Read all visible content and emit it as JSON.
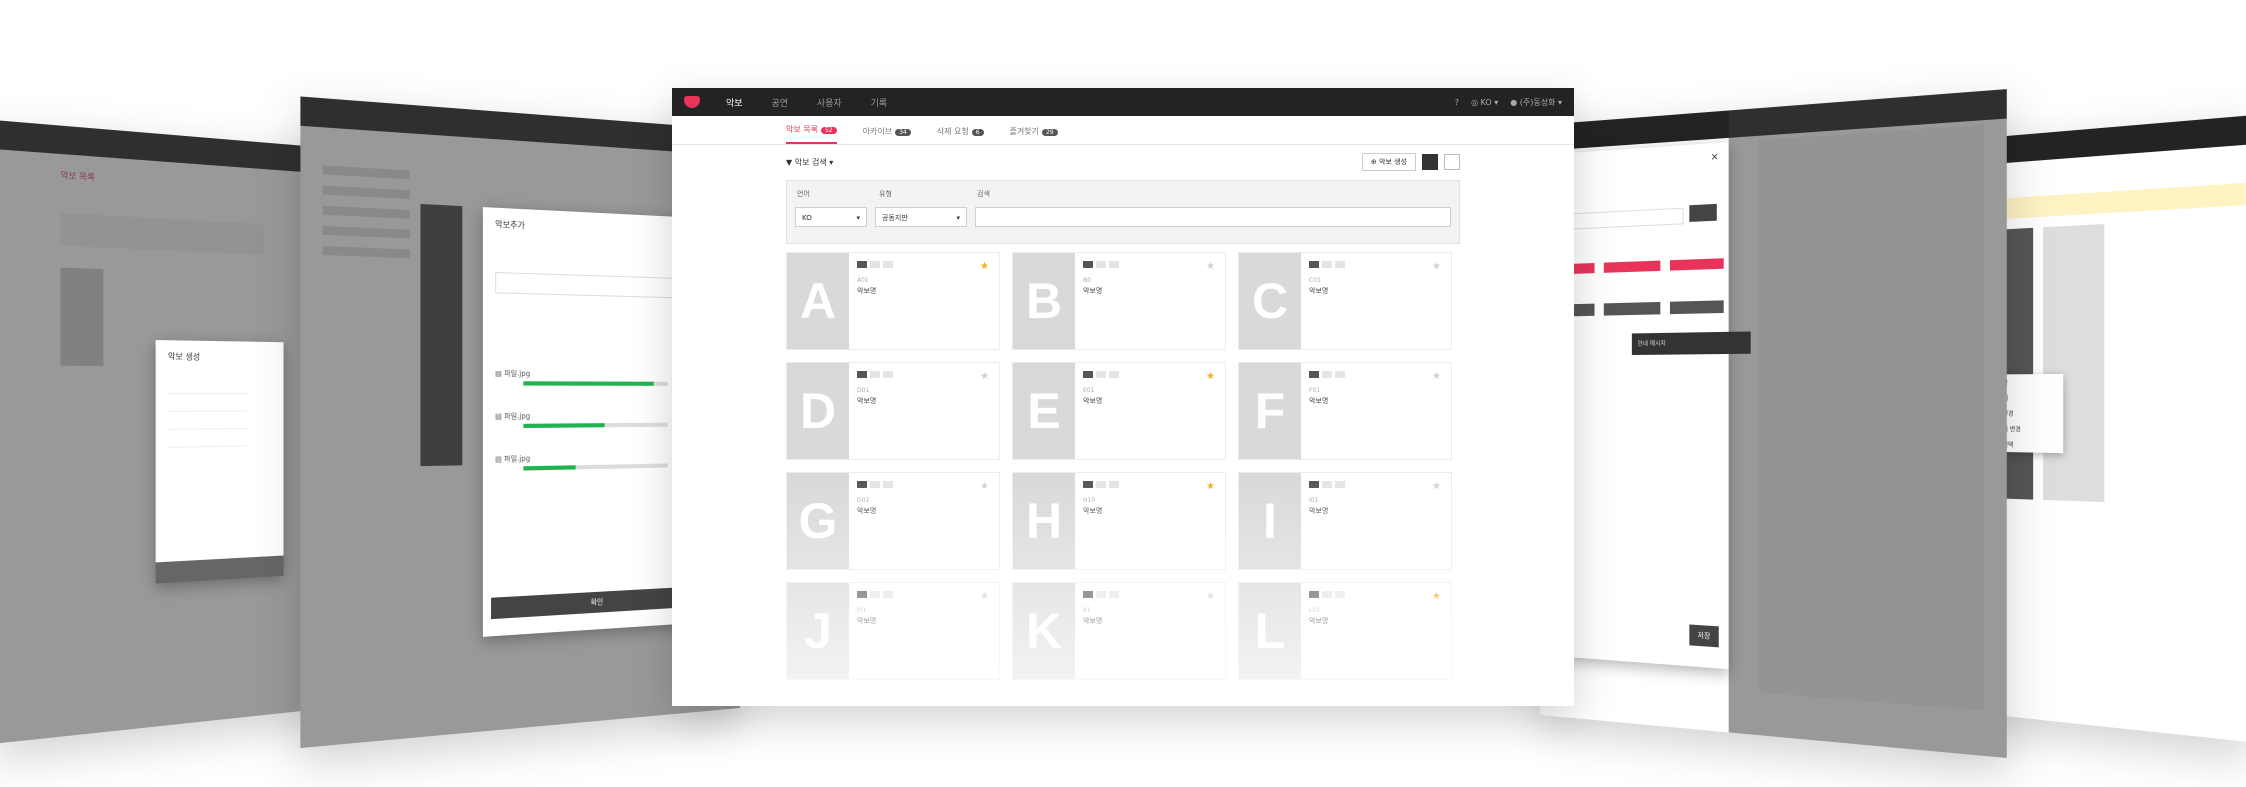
{
  "main": {
    "nav": [
      "악보",
      "공연",
      "사용자",
      "기록"
    ],
    "active_nav": "악보",
    "header_right": {
      "lang": "KO",
      "user": "(주)동성화"
    },
    "tabs": [
      {
        "label": "악보 목록",
        "count": "52"
      },
      {
        "label": "아카이브",
        "count": "34"
      },
      {
        "label": "삭제 요청",
        "count": "6"
      },
      {
        "label": "즐겨찾기",
        "count": "29"
      }
    ],
    "toolbar": {
      "filter_label": "악보 검색",
      "create_label": "악보 생성"
    },
    "filters": {
      "lang_label": "언어",
      "lang_value": "KO",
      "type_label": "유형",
      "type_value": "공동지판",
      "search_label": "검색",
      "search_placeholder": ""
    },
    "cards": [
      {
        "letter": "A",
        "id": "A01",
        "name": "악보명",
        "fav": true
      },
      {
        "letter": "B",
        "id": "B0",
        "name": "악보명",
        "fav": false
      },
      {
        "letter": "C",
        "id": "C01",
        "name": "악보명",
        "fav": false
      },
      {
        "letter": "D",
        "id": "D01",
        "name": "악보명",
        "fav": false
      },
      {
        "letter": "E",
        "id": "E01",
        "name": "악보명",
        "fav": true
      },
      {
        "letter": "F",
        "id": "F01",
        "name": "악보명",
        "fav": false
      },
      {
        "letter": "G",
        "id": "G02",
        "name": "악보명",
        "fav": false
      },
      {
        "letter": "H",
        "id": "H10",
        "name": "악보명",
        "fav": true
      },
      {
        "letter": "I",
        "id": "I01",
        "name": "악보명",
        "fav": false
      },
      {
        "letter": "J",
        "id": "J01",
        "name": "악보명",
        "fav": false
      },
      {
        "letter": "K",
        "id": "K1",
        "name": "악보명",
        "fav": false
      },
      {
        "letter": "L",
        "id": "L01",
        "name": "악보명",
        "fav": true
      }
    ]
  },
  "left_back": {
    "modal_title": "악보 생성",
    "tab": "악보 목록"
  },
  "left_mid": {
    "modal_title": "악보추가",
    "files": [
      {
        "name": "파일.jpg",
        "progress": 0.9
      },
      {
        "name": "파일.jpg",
        "progress": 0.55
      },
      {
        "name": "파일.jpg",
        "progress": 0.35
      }
    ],
    "confirm_label": "확인"
  },
  "right_mid": {
    "tooltip_title": "안내 메시지",
    "save_label": "저장"
  },
  "right_back": {
    "menu_items": [
      "음 추가",
      "음 삭제",
      "박자 변경",
      "음 위치 변경",
      "박자 선택"
    ]
  },
  "colors": {
    "accent": "#e8345a",
    "topbar": "#232323",
    "placeholder": "#d9d9d9",
    "star": "#f2b01e",
    "progress": "#21b351"
  }
}
